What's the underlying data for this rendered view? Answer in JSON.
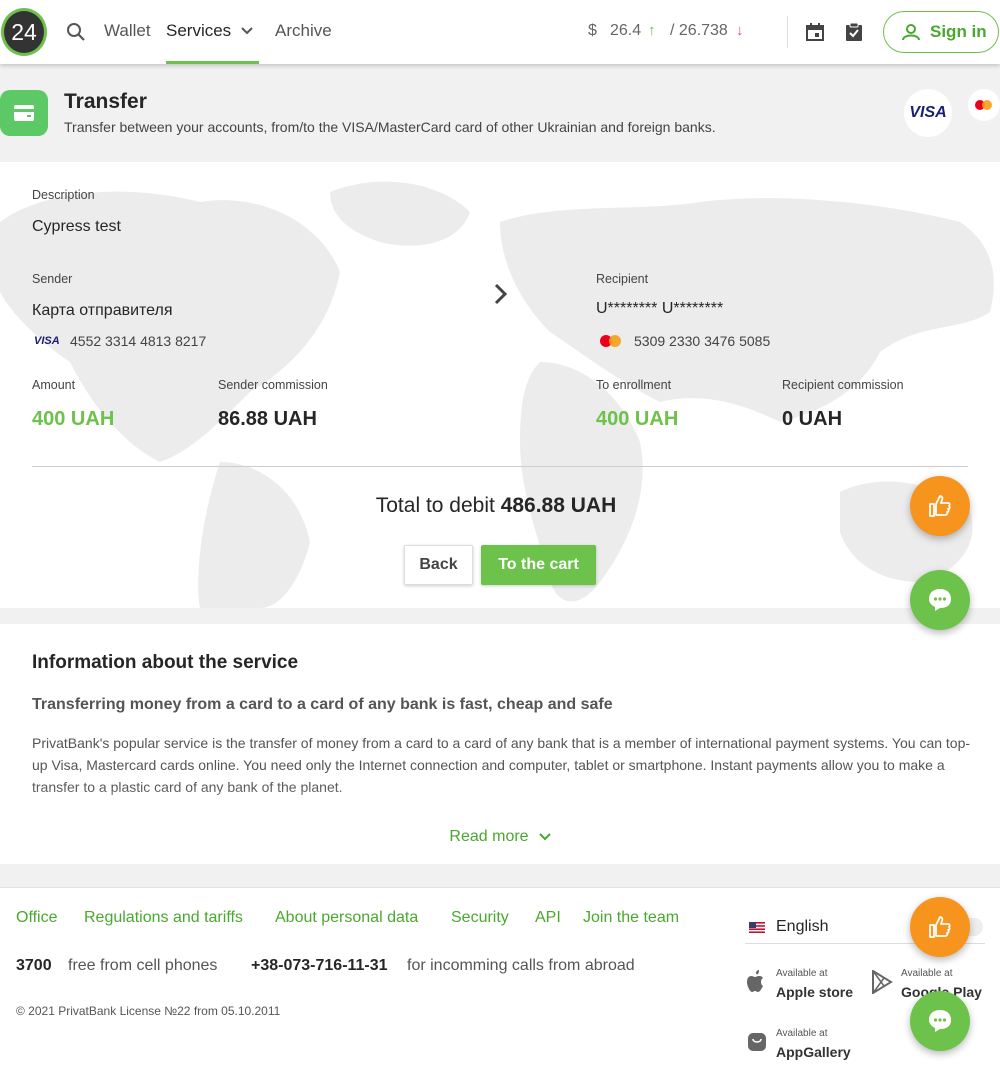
{
  "header": {
    "logo_text": "24",
    "nav": {
      "wallet": "Wallet",
      "services": "Services",
      "archive": "Archive"
    },
    "rates": {
      "currency_symbol": "$",
      "buy": "26.4",
      "buy_arrow": "↑",
      "sell": "/ 26.738",
      "sell_arrow": "↓"
    },
    "signin_label": "Sign in"
  },
  "page": {
    "title": "Transfer",
    "subtitle": "Transfer between your accounts, from/to the VISA/MasterCard card of other Ukrainian and foreign banks.",
    "visa_badge": "VISA"
  },
  "transfer": {
    "description_label": "Description",
    "description_value": "Cypress test",
    "sender_label": "Sender",
    "sender_name": "Карта отправителя",
    "sender_card_brand": "VISA",
    "sender_card_number": "4552 3314 4813 8217",
    "recipient_label": "Recipient",
    "recipient_name": "U******** U********",
    "recipient_card_number": "5309 2330 3476 5085",
    "amount_label": "Amount",
    "amount_value": "400 UAH",
    "sender_commission_label": "Sender commission",
    "sender_commission_value": "86.88 UAH",
    "enrollment_label": "To enrollment",
    "enrollment_value": "400 UAH",
    "recipient_commission_label": "Recipient commission",
    "recipient_commission_value": "0 UAH",
    "total_label": "Total to debit",
    "total_value": "486.88 UAH",
    "back_label": "Back",
    "cart_label": "To the cart"
  },
  "info": {
    "title": "Information about the service",
    "subtitle": "Transferring money from a card to a card of any bank is fast, cheap and safe",
    "body": "PrivatBank's popular service is the transfer of money from a card to a card of any bank that is a member of international payment systems. You can top-up Visa, Mastercard cards online. You need only the Internet connection and computer, tablet or smartphone. Instant payments allow you to make a transfer to a plastic card of any bank of the planet.",
    "read_more": "Read more"
  },
  "footer": {
    "links": [
      "Office",
      "Regulations and tariffs",
      "About personal data",
      "Security",
      "API",
      "Join the team"
    ],
    "phone1_number": "3700",
    "phone1_text": "free from cell phones",
    "phone2_number": "+38-073-716-11-31",
    "phone2_text": "for incomming calls from abroad",
    "copyright": "© 2021 PrivatBank License №22 from 05.10.2011",
    "language": "English",
    "stores": [
      {
        "avail": "Available at",
        "name": "Apple store"
      },
      {
        "avail": "Available at",
        "name": "Google Play"
      },
      {
        "avail": "Available at",
        "name": "AppGallery"
      }
    ]
  },
  "colors": {
    "accent": "#6cc24a",
    "fab_orange": "#f7941d",
    "visa_blue": "#1a1f71",
    "rate_down": "#ff4477"
  }
}
